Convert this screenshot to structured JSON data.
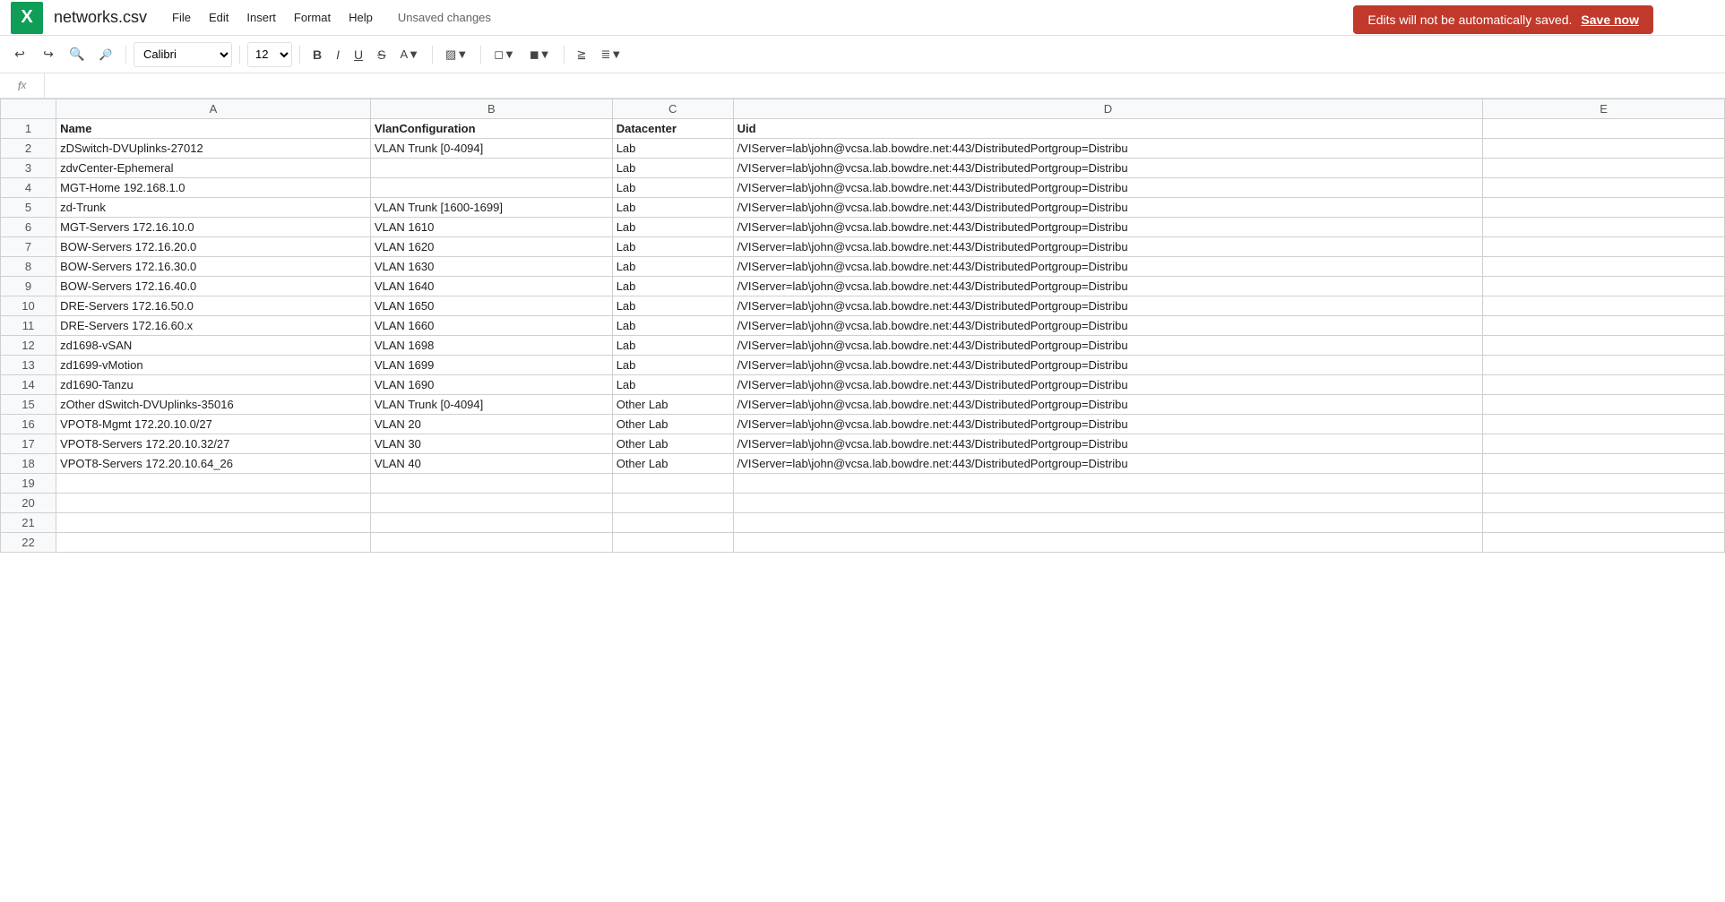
{
  "app": {
    "logo": "X",
    "title": "networks.csv",
    "menu_items": [
      "File",
      "Edit",
      "Insert",
      "Format",
      "Help"
    ],
    "unsaved_label": "Unsaved changes"
  },
  "banner": {
    "message": "Edits will not be automatically saved.",
    "save_label": "Save now"
  },
  "toolbar": {
    "font": "Calibri",
    "font_size": "12"
  },
  "columns": {
    "row_col": "",
    "a": "A",
    "b": "B",
    "c": "C",
    "d": "D",
    "e": "E"
  },
  "rows": [
    {
      "num": "1",
      "a": "Name",
      "b": "VlanConfiguration",
      "c": "Datacenter",
      "d": "Uid"
    },
    {
      "num": "2",
      "a": "zDSwitch-DVUplinks-27012",
      "b": "VLAN Trunk [0-4094]",
      "c": "Lab",
      "d": "/VIServer=lab\\john@vcsa.lab.bowdre.net:443/DistributedPortgroup=Distribu"
    },
    {
      "num": "3",
      "a": "zdvCenter-Ephemeral",
      "b": "",
      "c": "Lab",
      "d": "/VIServer=lab\\john@vcsa.lab.bowdre.net:443/DistributedPortgroup=Distribu"
    },
    {
      "num": "4",
      "a": "MGT-Home 192.168.1.0",
      "b": "",
      "c": "Lab",
      "d": "/VIServer=lab\\john@vcsa.lab.bowdre.net:443/DistributedPortgroup=Distribu"
    },
    {
      "num": "5",
      "a": "zd-Trunk",
      "b": "VLAN Trunk [1600-1699]",
      "c": "Lab",
      "d": "/VIServer=lab\\john@vcsa.lab.bowdre.net:443/DistributedPortgroup=Distribu"
    },
    {
      "num": "6",
      "a": "MGT-Servers 172.16.10.0",
      "b": "VLAN 1610",
      "c": "Lab",
      "d": "/VIServer=lab\\john@vcsa.lab.bowdre.net:443/DistributedPortgroup=Distribu"
    },
    {
      "num": "7",
      "a": "BOW-Servers 172.16.20.0",
      "b": "VLAN 1620",
      "c": "Lab",
      "d": "/VIServer=lab\\john@vcsa.lab.bowdre.net:443/DistributedPortgroup=Distribu"
    },
    {
      "num": "8",
      "a": "BOW-Servers 172.16.30.0",
      "b": "VLAN 1630",
      "c": "Lab",
      "d": "/VIServer=lab\\john@vcsa.lab.bowdre.net:443/DistributedPortgroup=Distribu"
    },
    {
      "num": "9",
      "a": "BOW-Servers 172.16.40.0",
      "b": "VLAN 1640",
      "c": "Lab",
      "d": "/VIServer=lab\\john@vcsa.lab.bowdre.net:443/DistributedPortgroup=Distribu"
    },
    {
      "num": "10",
      "a": "DRE-Servers 172.16.50.0",
      "b": "VLAN 1650",
      "c": "Lab",
      "d": "/VIServer=lab\\john@vcsa.lab.bowdre.net:443/DistributedPortgroup=Distribu"
    },
    {
      "num": "11",
      "a": "DRE-Servers 172.16.60.x",
      "b": "VLAN 1660",
      "c": "Lab",
      "d": "/VIServer=lab\\john@vcsa.lab.bowdre.net:443/DistributedPortgroup=Distribu"
    },
    {
      "num": "12",
      "a": "zd1698-vSAN",
      "b": "VLAN 1698",
      "c": "Lab",
      "d": "/VIServer=lab\\john@vcsa.lab.bowdre.net:443/DistributedPortgroup=Distribu"
    },
    {
      "num": "13",
      "a": "zd1699-vMotion",
      "b": "VLAN 1699",
      "c": "Lab",
      "d": "/VIServer=lab\\john@vcsa.lab.bowdre.net:443/DistributedPortgroup=Distribu"
    },
    {
      "num": "14",
      "a": "zd1690-Tanzu",
      "b": "VLAN 1690",
      "c": "Lab",
      "d": "/VIServer=lab\\john@vcsa.lab.bowdre.net:443/DistributedPortgroup=Distribu"
    },
    {
      "num": "15",
      "a": "zOther dSwitch-DVUplinks-35016",
      "b": "VLAN Trunk [0-4094]",
      "c": "Other Lab",
      "d": "/VIServer=lab\\john@vcsa.lab.bowdre.net:443/DistributedPortgroup=Distribu"
    },
    {
      "num": "16",
      "a": "VPOT8-Mgmt 172.20.10.0/27",
      "b": "VLAN 20",
      "c": "Other Lab",
      "d": "/VIServer=lab\\john@vcsa.lab.bowdre.net:443/DistributedPortgroup=Distribu"
    },
    {
      "num": "17",
      "a": "VPOT8-Servers 172.20.10.32/27",
      "b": "VLAN 30",
      "c": "Other Lab",
      "d": "/VIServer=lab\\john@vcsa.lab.bowdre.net:443/DistributedPortgroup=Distribu"
    },
    {
      "num": "18",
      "a": "VPOT8-Servers 172.20.10.64_26",
      "b": "VLAN 40",
      "c": "Other Lab",
      "d": "/VIServer=lab\\john@vcsa.lab.bowdre.net:443/DistributedPortgroup=Distribu"
    },
    {
      "num": "19",
      "a": "",
      "b": "",
      "c": "",
      "d": ""
    },
    {
      "num": "20",
      "a": "",
      "b": "",
      "c": "",
      "d": ""
    },
    {
      "num": "21",
      "a": "",
      "b": "",
      "c": "",
      "d": ""
    },
    {
      "num": "22",
      "a": "",
      "b": "",
      "c": "",
      "d": ""
    }
  ]
}
